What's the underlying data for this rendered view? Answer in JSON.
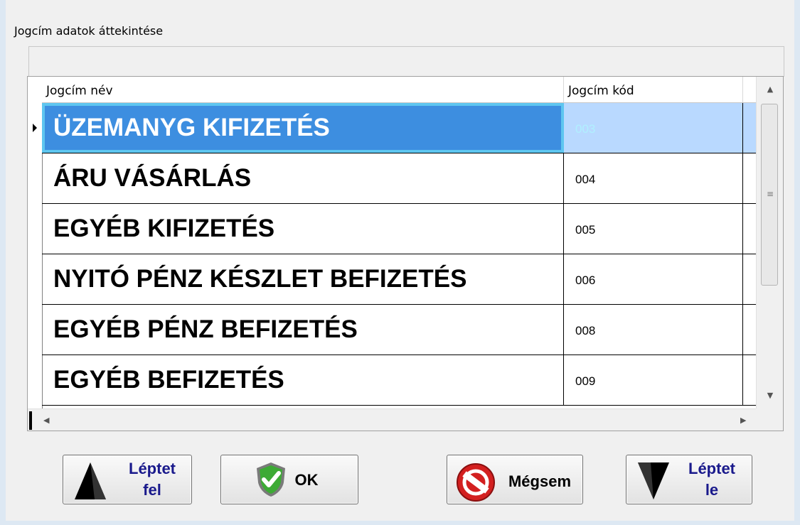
{
  "window": {
    "title": "Jogcím adatok áttekintése"
  },
  "grid": {
    "columns": [
      "Jogcím név",
      "Jogcím kód"
    ],
    "rows": [
      {
        "name": "ÜZEMANYG KIFIZETÉS",
        "code": "003",
        "selected": true
      },
      {
        "name": "ÁRU VÁSÁRLÁS",
        "code": "004"
      },
      {
        "name": "EGYÉB KIFIZETÉS",
        "code": "005"
      },
      {
        "name": "NYITÓ PÉNZ KÉSZLET BEFIZETÉS",
        "code": "006"
      },
      {
        "name": "EGYÉB PÉNZ BEFIZETÉS",
        "code": "008"
      },
      {
        "name": "EGYÉB BEFIZETÉS",
        "code": "009"
      }
    ]
  },
  "buttons": {
    "up_line1": "Léptet",
    "up_line2": "fel",
    "ok": "OK",
    "cancel": "Mégsem",
    "down_line1": "Léptet",
    "down_line2": "le"
  },
  "icons": {
    "up": "triangle-up-icon",
    "ok": "green-shield-check-icon",
    "cancel": "red-no-entry-icon",
    "down": "triangle-down-icon"
  }
}
